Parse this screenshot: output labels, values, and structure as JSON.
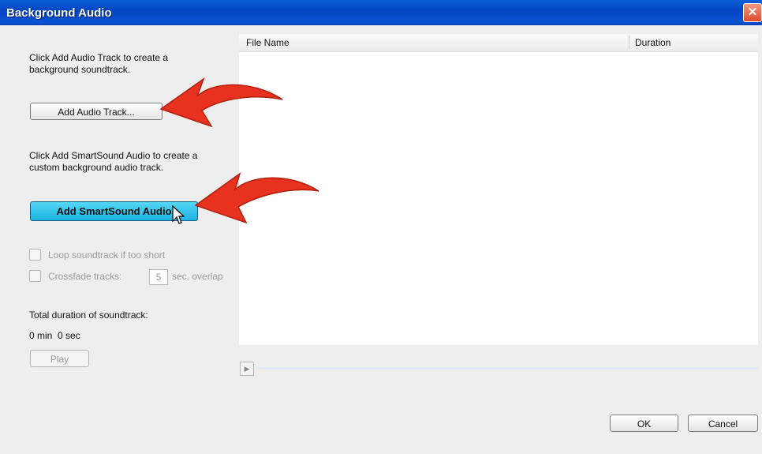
{
  "window": {
    "title": "Background Audio",
    "close_glyph": "✕"
  },
  "left": {
    "instruction_audio": "Click Add Audio Track to create a background soundtrack.",
    "add_audio_label": "Add Audio Track...",
    "instruction_smartsound": "Click Add SmartSound Audio to create a custom background audio track.",
    "add_smartsound_label": "Add SmartSound Audio",
    "loop_label": "Loop soundtrack if too short",
    "crossfade_label": "Crossfade tracks:",
    "crossfade_value": "5",
    "crossfade_suffix": "sec. overlap",
    "total_duration_label": "Total duration of soundtrack:",
    "total_duration_value": "0 min  0 sec",
    "play_label": "Play"
  },
  "list": {
    "remove_glyph": "✕",
    "columns": [
      "File Name",
      "Duration"
    ]
  },
  "footer": {
    "ok_label": "OK",
    "cancel_label": "Cancel"
  }
}
